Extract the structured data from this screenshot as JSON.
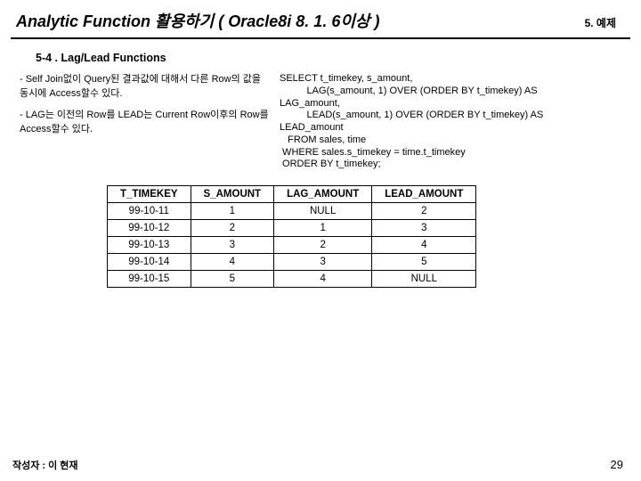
{
  "header": {
    "title": "Analytic Function 활용하기 ( Oracle8i 8. 1. 6이상 )",
    "chapter": "5. 예제"
  },
  "section": "5-4 . Lag/Lead Functions",
  "desc": {
    "p1": "- Self Join없이 Query된 결과값에 대해서 다른 Row의 값을 동시에 Access할수 있다.",
    "p2": "- LAG는 이전의 Row를 LEAD는 Current Row이후의 Row를 Access할수 있다."
  },
  "sql": "SELECT t_timekey, s_amount,\n          LAG(s_amount, 1) OVER (ORDER BY t_timekey) AS\nLAG_amount,\n          LEAD(s_amount, 1) OVER (ORDER BY t_timekey) AS\nLEAD_amount\n   FROM sales, time\n WHERE sales.s_timekey = time.t_timekey\n ORDER BY t_timekey;",
  "table": {
    "headers": [
      "T_TIMEKEY",
      "S_AMOUNT",
      "LAG_AMOUNT",
      "LEAD_AMOUNT"
    ],
    "rows": [
      [
        "99-10-11",
        "1",
        "NULL",
        "2"
      ],
      [
        "99-10-12",
        "2",
        "1",
        "3"
      ],
      [
        "99-10-13",
        "3",
        "2",
        "4"
      ],
      [
        "99-10-14",
        "4",
        "3",
        "5"
      ],
      [
        "99-10-15",
        "5",
        "4",
        "NULL"
      ]
    ]
  },
  "footer": {
    "author": "작성자 : 이 현재",
    "page": "29"
  }
}
